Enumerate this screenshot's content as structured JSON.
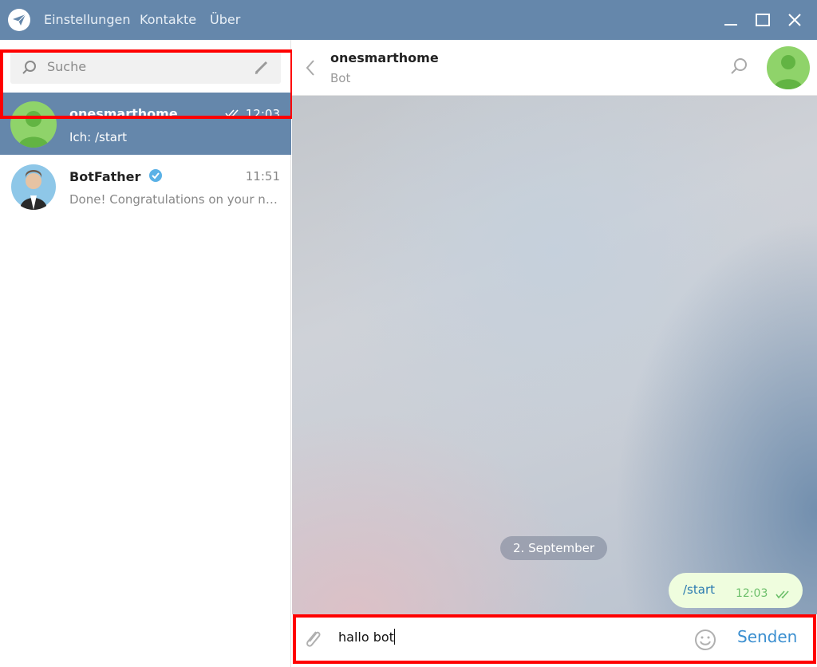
{
  "titlebar": {
    "menu": [
      "Einstellungen",
      "Kontakte",
      "Über"
    ]
  },
  "search": {
    "placeholder": "Suche"
  },
  "chats": [
    {
      "name": "onesmarthome",
      "time": "12:03",
      "preview": "Ich: /start",
      "status": "read",
      "active": true
    },
    {
      "name": "BotFather",
      "time": "11:51",
      "preview": "Done! Congratulations on your new bot. You will find it at",
      "verified": true,
      "active": false
    }
  ],
  "conversation": {
    "name": "onesmarthome",
    "status": "Bot",
    "date_separator": "2. September",
    "messages": [
      {
        "text": "/start",
        "time": "12:03",
        "outgoing": true,
        "status": "read"
      }
    ]
  },
  "composer": {
    "input_value": "hallo bot",
    "send_label": "Senden"
  },
  "colors": {
    "titlebar": "#6587ab",
    "active_chat": "#6587ab",
    "outgoing_bubble": "#effdde",
    "send_button": "#3b8fd0",
    "highlight": "#ff0000"
  }
}
